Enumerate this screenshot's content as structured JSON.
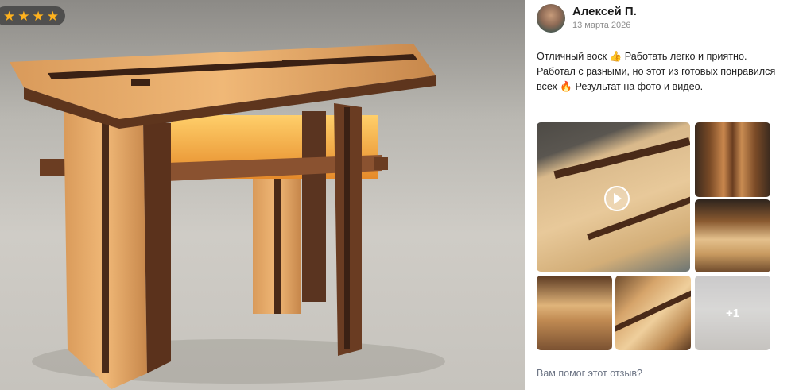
{
  "review": {
    "rating_stars": [
      "★",
      "★",
      "★",
      "★"
    ],
    "author": "Алексей П.",
    "date": "13 марта 2026",
    "text": "Отличный воск 👍 Работать легко и приятно. Работал с разными, но этот из готовых понравился всех 🔥 Результат на фото и видео.",
    "more_media_label": "+1",
    "helpful_question": "Вам помог этот отзыв?"
  },
  "icons": {
    "star": "star-icon",
    "play": "play-icon",
    "thumbs_up": "thumbs-up-emoji",
    "fire": "fire-emoji"
  },
  "colors": {
    "star": "#ffb21e",
    "author_text": "#1a1a1a",
    "muted_text": "#8d8d8d",
    "link_text": "#6d7585"
  }
}
